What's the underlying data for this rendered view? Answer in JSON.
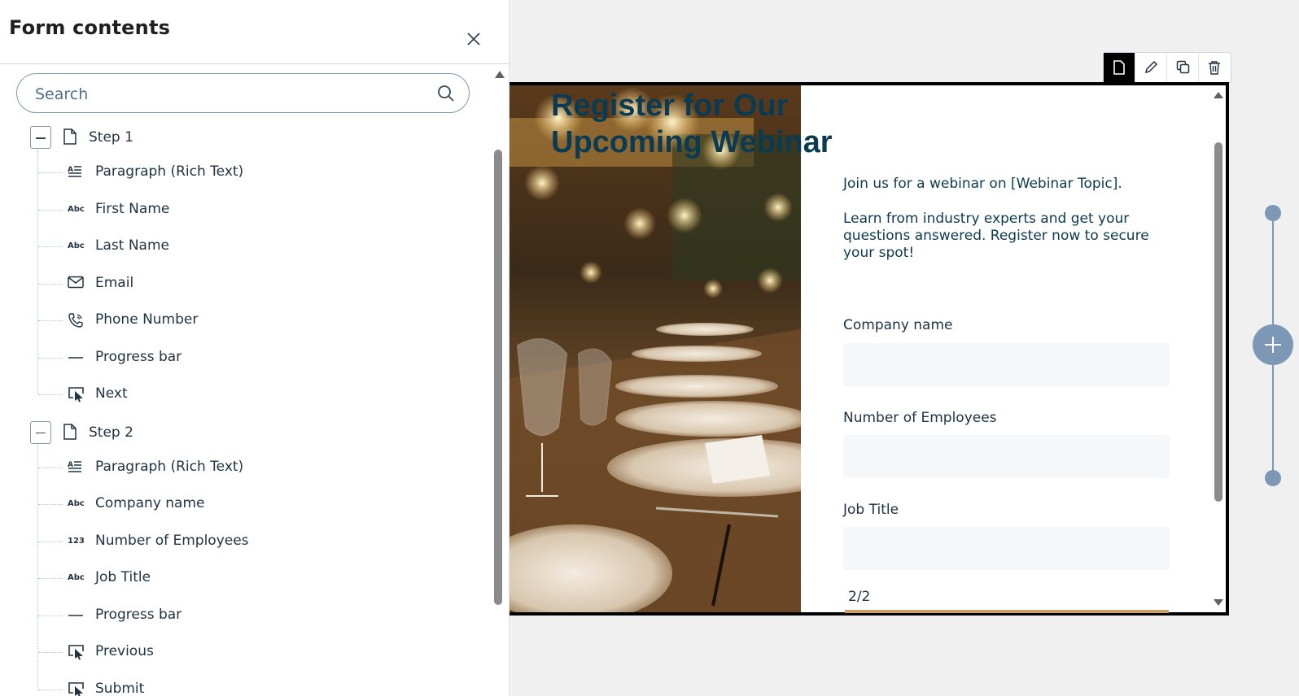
{
  "panel": {
    "title": "Form contents",
    "search_placeholder": "Search"
  },
  "tree": {
    "steps": [
      {
        "label": "Step 1",
        "items": [
          {
            "icon": "rich-text-icon",
            "label": "Paragraph (Rich Text)"
          },
          {
            "icon": "text-field-icon",
            "label": "First Name",
            "glyph": "Abc"
          },
          {
            "icon": "text-field-icon",
            "label": "Last Name",
            "glyph": "Abc"
          },
          {
            "icon": "email-icon",
            "label": "Email"
          },
          {
            "icon": "phone-icon",
            "label": "Phone Number"
          },
          {
            "icon": "progress-bar-icon",
            "label": "Progress bar"
          },
          {
            "icon": "button-cursor-icon",
            "label": "Next"
          }
        ]
      },
      {
        "label": "Step 2",
        "items": [
          {
            "icon": "rich-text-icon",
            "label": "Paragraph (Rich Text)"
          },
          {
            "icon": "text-field-icon",
            "label": "Company name",
            "glyph": "Abc"
          },
          {
            "icon": "number-field-icon",
            "label": "Number of Employees",
            "glyph": "123"
          },
          {
            "icon": "text-field-icon",
            "label": "Job Title",
            "glyph": "Abc"
          },
          {
            "icon": "progress-bar-icon",
            "label": "Progress bar"
          },
          {
            "icon": "button-cursor-icon",
            "label": "Previous"
          },
          {
            "icon": "button-cursor-icon",
            "label": "Submit"
          }
        ]
      }
    ]
  },
  "preview": {
    "headline": "Register for Our Upcoming Webinar",
    "intro": "Join us for a webinar on [Webinar Topic].",
    "body": "Learn from industry experts and get your questions answered. Register now to secure your spot!",
    "fields": [
      {
        "label": "Company name"
      },
      {
        "label": "Number of Employees"
      },
      {
        "label": "Job Title"
      }
    ],
    "progress": "2/2",
    "progress_fraction": 1.0
  },
  "toolbar": [
    "page-icon",
    "pencil-icon",
    "duplicate-icon",
    "trash-icon"
  ],
  "colors": {
    "headline": "#0b3a53",
    "accent": "#7c98b6",
    "toolbar_active": "#000000",
    "field_bg": "#f5f8fa"
  }
}
